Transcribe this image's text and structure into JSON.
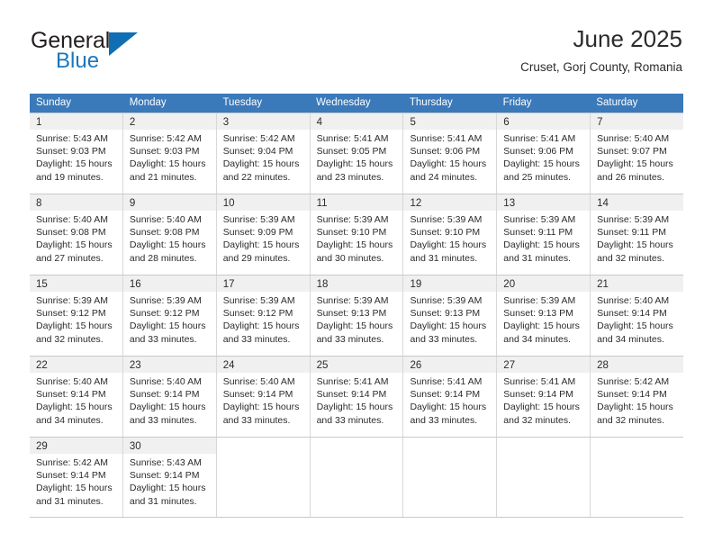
{
  "branding": {
    "word_primary": "General",
    "word_secondary": "Blue",
    "primary_color": "#231f20",
    "secondary_color": "#1b76bc",
    "triangle_color": "#0f6eb4"
  },
  "header": {
    "title": "June 2025",
    "subtitle": "Cruset, Gorj County, Romania"
  },
  "calendar": {
    "header_bg": "#3a79ba",
    "header_text_color": "#ffffff",
    "daynum_strip_bg": "#f0f0f0",
    "weekdays": [
      "Sunday",
      "Monday",
      "Tuesday",
      "Wednesday",
      "Thursday",
      "Friday",
      "Saturday"
    ],
    "weeks": [
      [
        {
          "day": "1",
          "sunrise": "Sunrise: 5:43 AM",
          "sunset": "Sunset: 9:03 PM",
          "daylight1": "Daylight: 15 hours",
          "daylight2": "and 19 minutes."
        },
        {
          "day": "2",
          "sunrise": "Sunrise: 5:42 AM",
          "sunset": "Sunset: 9:03 PM",
          "daylight1": "Daylight: 15 hours",
          "daylight2": "and 21 minutes."
        },
        {
          "day": "3",
          "sunrise": "Sunrise: 5:42 AM",
          "sunset": "Sunset: 9:04 PM",
          "daylight1": "Daylight: 15 hours",
          "daylight2": "and 22 minutes."
        },
        {
          "day": "4",
          "sunrise": "Sunrise: 5:41 AM",
          "sunset": "Sunset: 9:05 PM",
          "daylight1": "Daylight: 15 hours",
          "daylight2": "and 23 minutes."
        },
        {
          "day": "5",
          "sunrise": "Sunrise: 5:41 AM",
          "sunset": "Sunset: 9:06 PM",
          "daylight1": "Daylight: 15 hours",
          "daylight2": "and 24 minutes."
        },
        {
          "day": "6",
          "sunrise": "Sunrise: 5:41 AM",
          "sunset": "Sunset: 9:06 PM",
          "daylight1": "Daylight: 15 hours",
          "daylight2": "and 25 minutes."
        },
        {
          "day": "7",
          "sunrise": "Sunrise: 5:40 AM",
          "sunset": "Sunset: 9:07 PM",
          "daylight1": "Daylight: 15 hours",
          "daylight2": "and 26 minutes."
        }
      ],
      [
        {
          "day": "8",
          "sunrise": "Sunrise: 5:40 AM",
          "sunset": "Sunset: 9:08 PM",
          "daylight1": "Daylight: 15 hours",
          "daylight2": "and 27 minutes."
        },
        {
          "day": "9",
          "sunrise": "Sunrise: 5:40 AM",
          "sunset": "Sunset: 9:08 PM",
          "daylight1": "Daylight: 15 hours",
          "daylight2": "and 28 minutes."
        },
        {
          "day": "10",
          "sunrise": "Sunrise: 5:39 AM",
          "sunset": "Sunset: 9:09 PM",
          "daylight1": "Daylight: 15 hours",
          "daylight2": "and 29 minutes."
        },
        {
          "day": "11",
          "sunrise": "Sunrise: 5:39 AM",
          "sunset": "Sunset: 9:10 PM",
          "daylight1": "Daylight: 15 hours",
          "daylight2": "and 30 minutes."
        },
        {
          "day": "12",
          "sunrise": "Sunrise: 5:39 AM",
          "sunset": "Sunset: 9:10 PM",
          "daylight1": "Daylight: 15 hours",
          "daylight2": "and 31 minutes."
        },
        {
          "day": "13",
          "sunrise": "Sunrise: 5:39 AM",
          "sunset": "Sunset: 9:11 PM",
          "daylight1": "Daylight: 15 hours",
          "daylight2": "and 31 minutes."
        },
        {
          "day": "14",
          "sunrise": "Sunrise: 5:39 AM",
          "sunset": "Sunset: 9:11 PM",
          "daylight1": "Daylight: 15 hours",
          "daylight2": "and 32 minutes."
        }
      ],
      [
        {
          "day": "15",
          "sunrise": "Sunrise: 5:39 AM",
          "sunset": "Sunset: 9:12 PM",
          "daylight1": "Daylight: 15 hours",
          "daylight2": "and 32 minutes."
        },
        {
          "day": "16",
          "sunrise": "Sunrise: 5:39 AM",
          "sunset": "Sunset: 9:12 PM",
          "daylight1": "Daylight: 15 hours",
          "daylight2": "and 33 minutes."
        },
        {
          "day": "17",
          "sunrise": "Sunrise: 5:39 AM",
          "sunset": "Sunset: 9:12 PM",
          "daylight1": "Daylight: 15 hours",
          "daylight2": "and 33 minutes."
        },
        {
          "day": "18",
          "sunrise": "Sunrise: 5:39 AM",
          "sunset": "Sunset: 9:13 PM",
          "daylight1": "Daylight: 15 hours",
          "daylight2": "and 33 minutes."
        },
        {
          "day": "19",
          "sunrise": "Sunrise: 5:39 AM",
          "sunset": "Sunset: 9:13 PM",
          "daylight1": "Daylight: 15 hours",
          "daylight2": "and 33 minutes."
        },
        {
          "day": "20",
          "sunrise": "Sunrise: 5:39 AM",
          "sunset": "Sunset: 9:13 PM",
          "daylight1": "Daylight: 15 hours",
          "daylight2": "and 34 minutes."
        },
        {
          "day": "21",
          "sunrise": "Sunrise: 5:40 AM",
          "sunset": "Sunset: 9:14 PM",
          "daylight1": "Daylight: 15 hours",
          "daylight2": "and 34 minutes."
        }
      ],
      [
        {
          "day": "22",
          "sunrise": "Sunrise: 5:40 AM",
          "sunset": "Sunset: 9:14 PM",
          "daylight1": "Daylight: 15 hours",
          "daylight2": "and 34 minutes."
        },
        {
          "day": "23",
          "sunrise": "Sunrise: 5:40 AM",
          "sunset": "Sunset: 9:14 PM",
          "daylight1": "Daylight: 15 hours",
          "daylight2": "and 33 minutes."
        },
        {
          "day": "24",
          "sunrise": "Sunrise: 5:40 AM",
          "sunset": "Sunset: 9:14 PM",
          "daylight1": "Daylight: 15 hours",
          "daylight2": "and 33 minutes."
        },
        {
          "day": "25",
          "sunrise": "Sunrise: 5:41 AM",
          "sunset": "Sunset: 9:14 PM",
          "daylight1": "Daylight: 15 hours",
          "daylight2": "and 33 minutes."
        },
        {
          "day": "26",
          "sunrise": "Sunrise: 5:41 AM",
          "sunset": "Sunset: 9:14 PM",
          "daylight1": "Daylight: 15 hours",
          "daylight2": "and 33 minutes."
        },
        {
          "day": "27",
          "sunrise": "Sunrise: 5:41 AM",
          "sunset": "Sunset: 9:14 PM",
          "daylight1": "Daylight: 15 hours",
          "daylight2": "and 32 minutes."
        },
        {
          "day": "28",
          "sunrise": "Sunrise: 5:42 AM",
          "sunset": "Sunset: 9:14 PM",
          "daylight1": "Daylight: 15 hours",
          "daylight2": "and 32 minutes."
        }
      ],
      [
        {
          "day": "29",
          "sunrise": "Sunrise: 5:42 AM",
          "sunset": "Sunset: 9:14 PM",
          "daylight1": "Daylight: 15 hours",
          "daylight2": "and 31 minutes."
        },
        {
          "day": "30",
          "sunrise": "Sunrise: 5:43 AM",
          "sunset": "Sunset: 9:14 PM",
          "daylight1": "Daylight: 15 hours",
          "daylight2": "and 31 minutes."
        },
        {
          "day": "",
          "sunrise": "",
          "sunset": "",
          "daylight1": "",
          "daylight2": ""
        },
        {
          "day": "",
          "sunrise": "",
          "sunset": "",
          "daylight1": "",
          "daylight2": ""
        },
        {
          "day": "",
          "sunrise": "",
          "sunset": "",
          "daylight1": "",
          "daylight2": ""
        },
        {
          "day": "",
          "sunrise": "",
          "sunset": "",
          "daylight1": "",
          "daylight2": ""
        },
        {
          "day": "",
          "sunrise": "",
          "sunset": "",
          "daylight1": "",
          "daylight2": ""
        }
      ]
    ]
  }
}
